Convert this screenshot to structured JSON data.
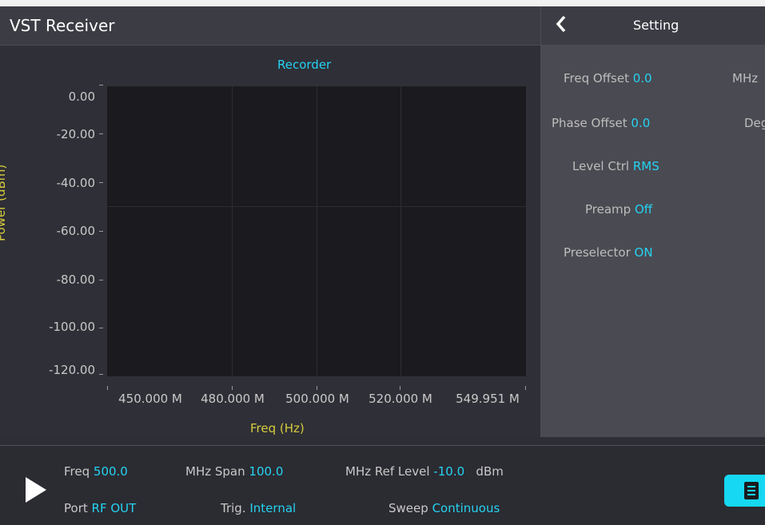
{
  "app": {
    "title": "VST Receiver"
  },
  "panel": {
    "title": "Setting",
    "rows": [
      {
        "label": "Freq Offset",
        "value": "0.0",
        "unit": "MHz"
      },
      {
        "label": "Phase Offset",
        "value": "0.0",
        "unit": "Deg"
      },
      {
        "label": "Level Ctrl",
        "value": "RMS"
      },
      {
        "label": "Preamp",
        "value": "Off"
      },
      {
        "label": "Preselector",
        "value": "ON"
      }
    ]
  },
  "chart_data": {
    "type": "line",
    "title": "Recorder",
    "xlabel": "Freq (Hz)",
    "ylabel": "Power (dBm)",
    "y_ticks": [
      "0.00",
      "-20.00",
      "-40.00",
      "-60.00",
      "-80.00",
      "-100.00",
      "-120.00"
    ],
    "x_ticks": [
      "450.000 M",
      "480.000 M",
      "500.000 M",
      "520.000 M",
      "549.951 M"
    ],
    "ylim": [
      -120,
      0
    ],
    "xlim": [
      "450.000 M",
      "549.951 M"
    ],
    "series": [],
    "grid": true
  },
  "bottom": {
    "freq_label": "Freq",
    "freq_value": "500.0",
    "freq_unit": "MHz",
    "span_label": "Span",
    "span_value": "100.0",
    "span_unit": "MHz",
    "ref_label": "Ref Level",
    "ref_value": "-10.0",
    "ref_unit": "dBm",
    "port_label": "Port",
    "port_value": "RF OUT",
    "trig_label": "Trig.",
    "trig_value": "Internal",
    "sweep_label": "Sweep",
    "sweep_value": "Continuous"
  }
}
